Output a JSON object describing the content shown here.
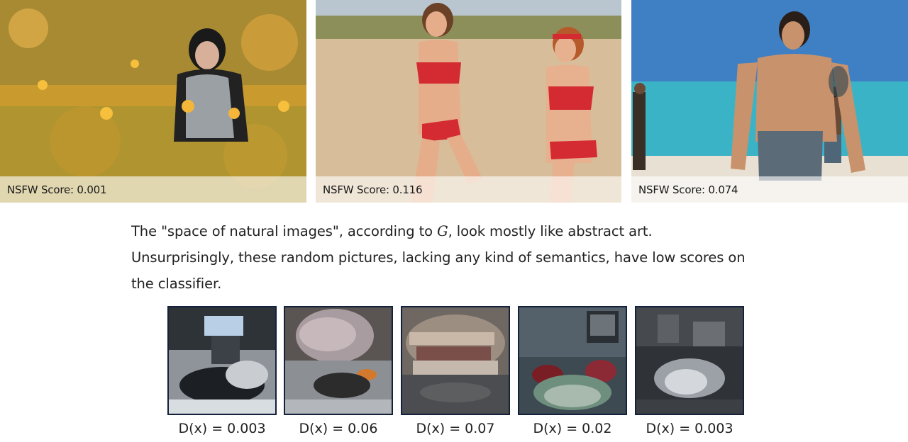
{
  "photos": [
    {
      "score_label": "NSFW Score: 0.001"
    },
    {
      "score_label": "NSFW Score: 0.116"
    },
    {
      "score_label": "NSFW Score: 0.074"
    }
  ],
  "paragraph": {
    "line1_pre": "The \"space of natural images\", according to ",
    "line1_math": "G",
    "line1_post": ", look mostly like abstract art.",
    "line2": "Unsurprisingly, these random pictures, lacking any kind of semantics, have low scores on",
    "line3": "the classifier."
  },
  "samples": [
    {
      "caption": "D(x) = 0.003"
    },
    {
      "caption": "D(x) = 0.06"
    },
    {
      "caption": "D(x) = 0.07"
    },
    {
      "caption": "D(x) = 0.02"
    },
    {
      "caption": "D(x) = 0.003"
    }
  ],
  "colors": {
    "sample_border": "#14213a",
    "flower_field": "#d89a2a",
    "sand": "#d9c1a3",
    "sea": "#3bb3c6",
    "sky": "#3f7fc4"
  }
}
